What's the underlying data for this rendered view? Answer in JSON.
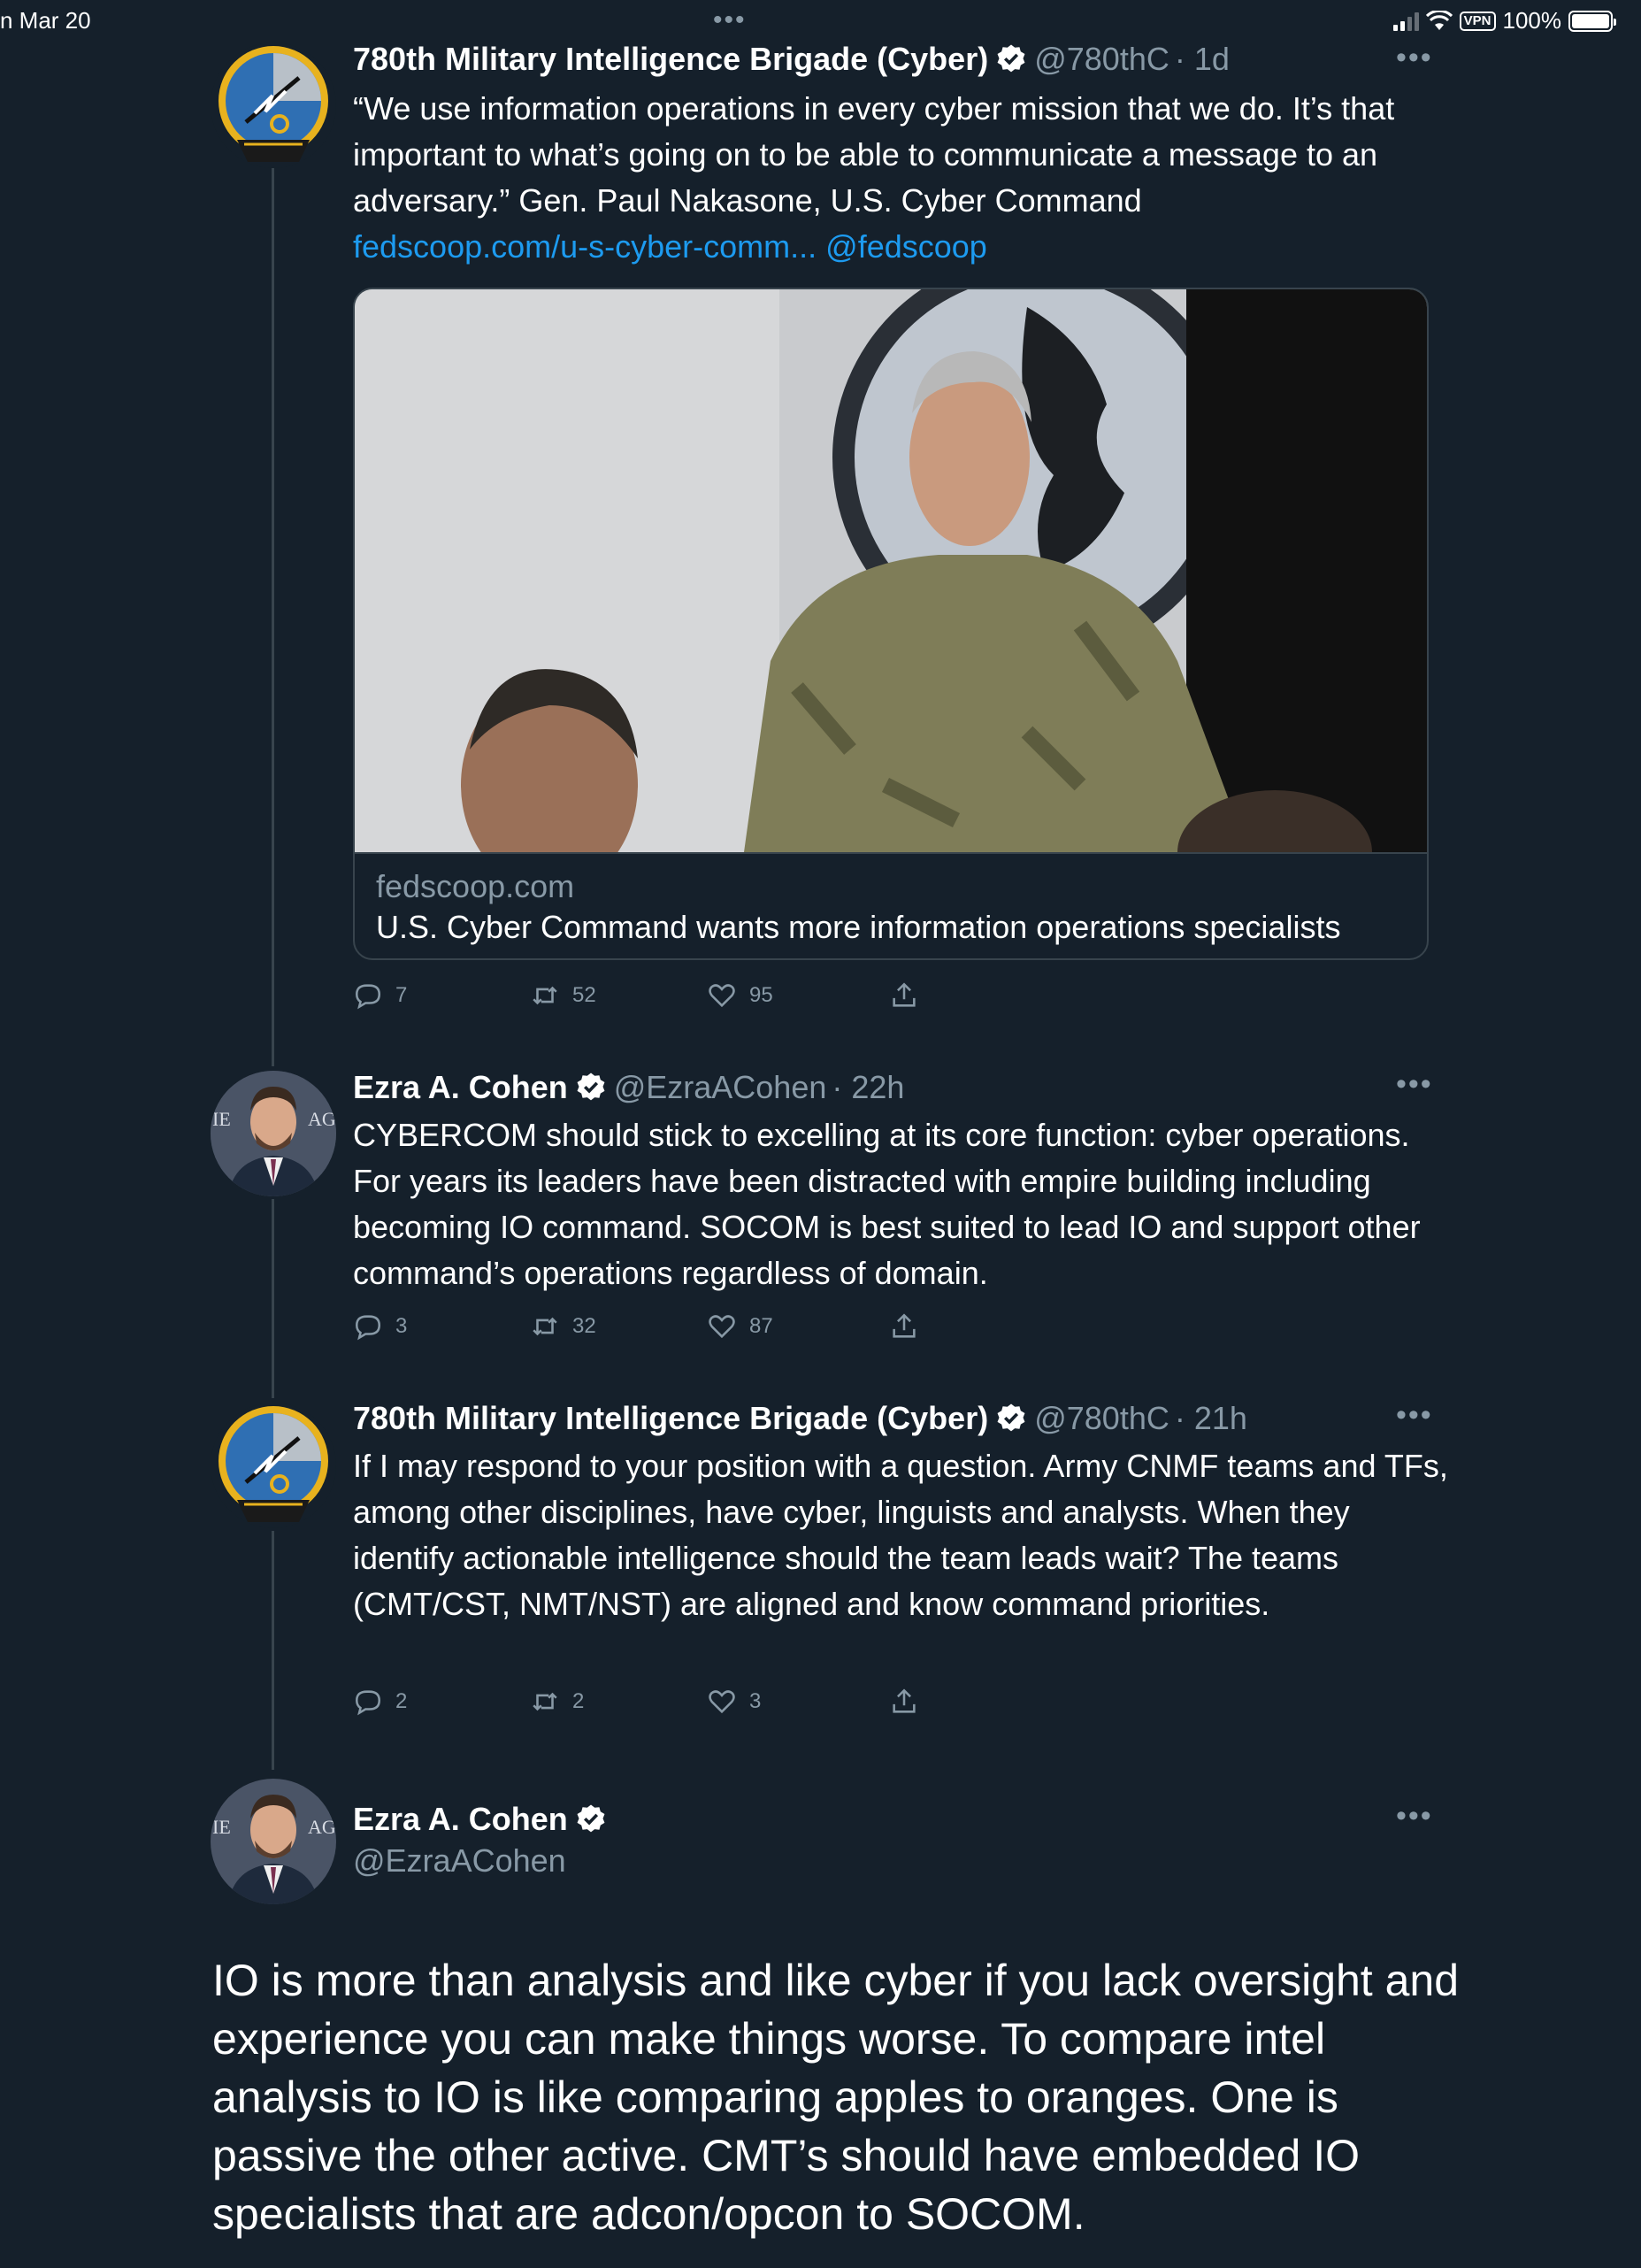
{
  "status_bar": {
    "date": "n Mar 20",
    "dots": "•••",
    "vpn": "VPN",
    "battery": "100%"
  },
  "tweets": [
    {
      "name": "780th Military Intelligence Brigade (Cyber)",
      "handle": "@780thC",
      "time": "· 1d",
      "text": "“We use information operations in every cyber mission that we do. It’s that important to what’s going on to be able to communicate a message to an adversary.” Gen. Paul Nakasone, U.S. Cyber Command",
      "link": "fedscoop.com/u-s-cyber-comm...",
      "mention": "@fedscoop",
      "card": {
        "domain": "fedscoop.com",
        "title": "U.S. Cyber Command wants more information operations specialists"
      },
      "replies": "7",
      "retweets": "52",
      "likes": "95"
    },
    {
      "name": "Ezra A. Cohen",
      "handle": "@EzraACohen",
      "time": "· 22h",
      "text": "CYBERCOM should stick to excelling at its core function: cyber operations. For years its leaders have been distracted with empire building including becoming IO command. SOCOM is best suited to lead IO and support other command’s operations regardless of domain.",
      "replies": "3",
      "retweets": "32",
      "likes": "87"
    },
    {
      "name": "780th Military Intelligence Brigade (Cyber)",
      "handle": "@780thC",
      "time": "· 21h",
      "text": "If I may respond to your position with a question. Army CNMF teams and TFs, among other disciplines, have cyber, linguists and analysts. When they identify actionable intelligence should the team leads wait? The teams (CMT/CST, NMT/NST) are aligned and know command priorities.",
      "replies": "2",
      "retweets": "2",
      "likes": "3"
    }
  ],
  "main_tweet": {
    "name": "Ezra A. Cohen",
    "handle": "@EzraACohen",
    "text": "IO is more than analysis and like cyber if you lack oversight and experience you can make things worse. To compare intel analysis to IO is like comparing apples to oranges.  One is passive the other active.  CMT’s should have embedded IO specialists that are adcon/opcon to SOCOM."
  },
  "colors": {
    "background": "#15202b",
    "secondary_text": "#8899a6",
    "link": "#1d9bf0",
    "border": "#38444d"
  }
}
